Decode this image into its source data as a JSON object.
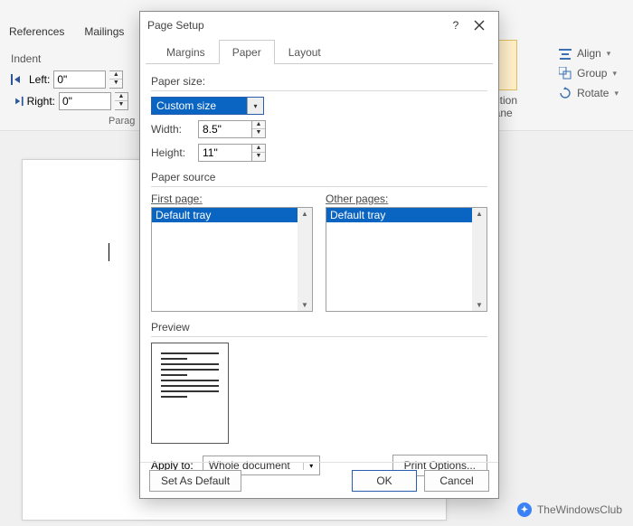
{
  "ribbon": {
    "tabs": [
      "References",
      "Mailings"
    ],
    "indent": {
      "title": "Indent",
      "left_label": "Left:",
      "left": "0\"",
      "right_label": "Right:",
      "right": "0\""
    },
    "group_label": "Parag",
    "side": {
      "align": "Align",
      "group": "Group",
      "rotate": "Rotate",
      "sel_text1": "ction",
      "sel_text2": "ane"
    }
  },
  "dialog": {
    "title": "Page Setup",
    "tabs": {
      "margins": "Margins",
      "paper": "Paper",
      "layout": "Layout"
    },
    "paper_size_label": "Paper size:",
    "paper_size_value": "Custom size",
    "width_label": "Width:",
    "width_value": "8.5\"",
    "height_label": "Height:",
    "height_value": "11\"",
    "paper_source_label": "Paper source",
    "first_page_label": "First page:",
    "first_page_value": "Default tray",
    "other_pages_label": "Other pages:",
    "other_pages_value": "Default tray",
    "preview_label": "Preview",
    "apply_to_label": "Apply to:",
    "apply_to_value": "Whole document",
    "print_options": "Print Options...",
    "set_default": "Set As Default",
    "ok": "OK",
    "cancel": "Cancel"
  },
  "watermark": "TheWindowsClub"
}
